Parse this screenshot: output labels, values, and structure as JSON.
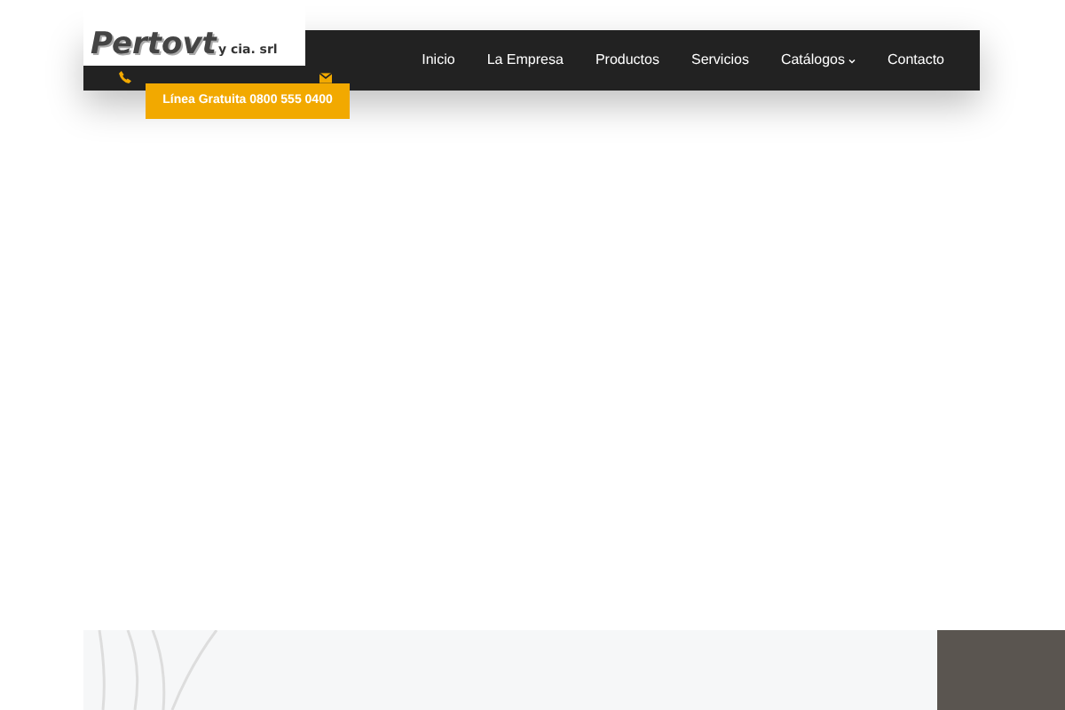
{
  "logo": {
    "name": "Pertovt",
    "suffix": "y cia. srl"
  },
  "contact_bar": {
    "phone_label": "Línea Gratuita 0800 555 0400"
  },
  "nav": [
    {
      "label": "Inicio",
      "dropdown": false
    },
    {
      "label": "La Empresa",
      "dropdown": false
    },
    {
      "label": "Productos",
      "dropdown": false
    },
    {
      "label": "Servicios",
      "dropdown": false
    },
    {
      "label": "Catálogos",
      "dropdown": true
    },
    {
      "label": "Contacto",
      "dropdown": false
    }
  ]
}
